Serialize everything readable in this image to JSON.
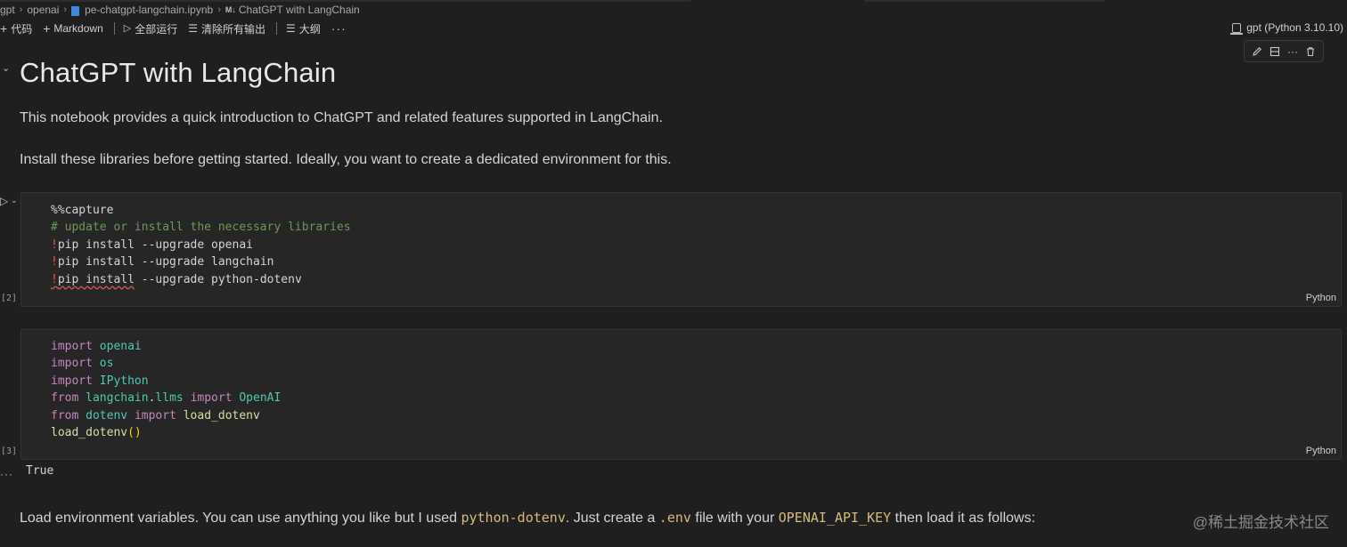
{
  "breadcrumb": {
    "items": [
      "gpt",
      "openai",
      "pe-chatgpt-langchain.ipynb",
      "ChatGPT with LangChain"
    ],
    "md_badge": "M↓"
  },
  "toolbar": {
    "add_code": "代码",
    "add_markdown": "Markdown",
    "run_all": "全部运行",
    "clear_outputs": "清除所有输出",
    "outline": "大纲",
    "more": "···"
  },
  "kernel": {
    "label": "gpt (Python 3.10.10)"
  },
  "notebook": {
    "title": "ChatGPT with LangChain",
    "intro": "This notebook provides a quick introduction to ChatGPT and related features supported in LangChain.",
    "install_note": "Install these libraries before getting started. Ideally, you want to create a dedicated environment for this.",
    "cell1": {
      "exec_count": "[2]",
      "language": "Python",
      "lines": {
        "magic": "%%capture",
        "comment": "# update or install the necessary libraries",
        "pip": "pip install",
        "flag": "--upgrade",
        "pkg1": "openai",
        "pkg2": "langchain",
        "pkg3": "python-dotenv"
      }
    },
    "cell2": {
      "exec_count": "[3]",
      "language": "Python",
      "import_kw": "import",
      "from_kw": "from",
      "mods": {
        "openai": "openai",
        "os": "os",
        "ipython": "IPython",
        "langchain_llms": "langchain",
        "llms": "llms",
        "openai_cls": "OpenAI",
        "dotenv": "dotenv",
        "load_dotenv": "load_dotenv"
      },
      "call": "load_dotenv",
      "output": "True"
    },
    "load_env": {
      "before": "Load environment variables. You can use anything you like but I used ",
      "code1": "python-dotenv",
      "mid1": ". Just create a ",
      "code2": ".env",
      "mid2": " file with your ",
      "code3": "OPENAI_API_KEY",
      "after": " then load it as follows:"
    }
  },
  "watermark": "@稀土掘金技术社区"
}
